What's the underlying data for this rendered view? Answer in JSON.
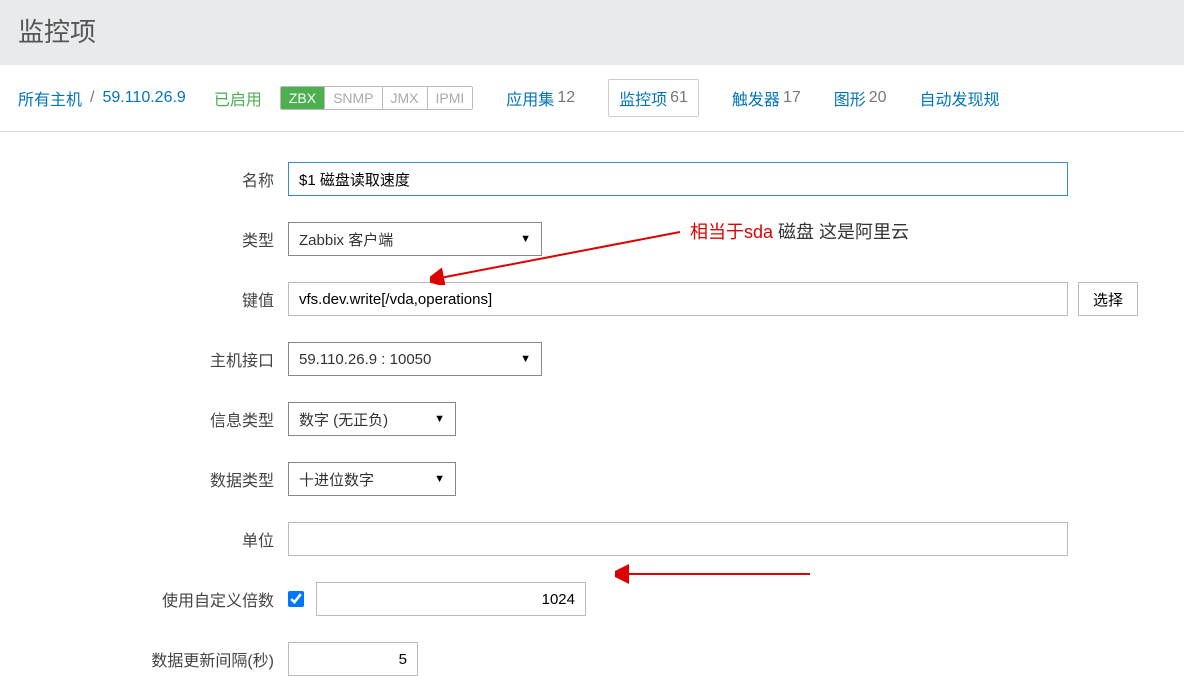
{
  "header": {
    "title": "监控项"
  },
  "breadcrumb": {
    "all_hosts": "所有主机",
    "sep": "/",
    "host": "59.110.26.9"
  },
  "status": {
    "enabled": "已启用"
  },
  "protos": {
    "zbx": "ZBX",
    "snmp": "SNMP",
    "jmx": "JMX",
    "ipmi": "IPMI"
  },
  "tabs": {
    "appset": {
      "label": "应用集",
      "count": "12"
    },
    "items": {
      "label": "监控项",
      "count": "61"
    },
    "trigger": {
      "label": "触发器",
      "count": "17"
    },
    "graph": {
      "label": "图形",
      "count": "20"
    },
    "discover": {
      "label": "自动发现规"
    }
  },
  "form": {
    "name_label": "名称",
    "name_value": "$1 磁盘读取速度",
    "type_label": "类型",
    "type_value": "Zabbix 客户端",
    "key_label": "键值",
    "key_value": "vfs.dev.write[/vda,operations]",
    "key_select_btn": "选择",
    "hostif_label": "主机接口",
    "hostif_value": "59.110.26.9 : 10050",
    "info_label": "信息类型",
    "info_value": "数字 (无正负)",
    "dtype_label": "数据类型",
    "dtype_value": "十进位数字",
    "unit_label": "单位",
    "unit_value": "",
    "mult_label": "使用自定义倍数",
    "mult_value": "1024",
    "interval_label": "数据更新间隔(秒)",
    "interval_value": "5"
  },
  "annotation": {
    "prefix": "相当于",
    "sda": "sda",
    "suffix": " 磁盘 这是阿里云"
  }
}
